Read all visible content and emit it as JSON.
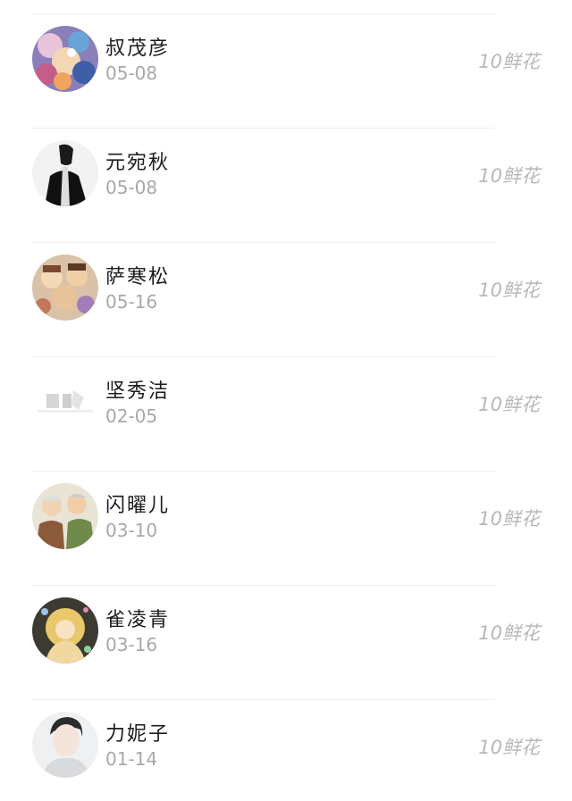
{
  "items": [
    {
      "name": "叔茂彦",
      "date": "05-08",
      "flowers": "10鲜花",
      "avatar": "colorful-anime-avatar"
    },
    {
      "name": "元宛秋",
      "date": "05-08",
      "flowers": "10鲜花",
      "avatar": "monochrome-person-avatar"
    },
    {
      "name": "萨寒松",
      "date": "05-16",
      "flowers": "10鲜花",
      "avatar": "group-cartoon-avatar"
    },
    {
      "name": "坚秀洁",
      "date": "02-05",
      "flowers": "10鲜花",
      "avatar": "blank-gray-avatar"
    },
    {
      "name": "闪曜儿",
      "date": "03-10",
      "flowers": "10鲜花",
      "avatar": "elderly-couple-avatar"
    },
    {
      "name": "雀凌青",
      "date": "03-16",
      "flowers": "10鲜花",
      "avatar": "golden-anime-girl-avatar"
    },
    {
      "name": "力妮子",
      "date": "01-14",
      "flowers": "10鲜花",
      "avatar": "young-man-avatar"
    }
  ],
  "colors": {
    "name": "#1c1c1c",
    "date": "#a8a8a8",
    "flowers": "#b8b8b8",
    "divider": "#eeeeee"
  }
}
